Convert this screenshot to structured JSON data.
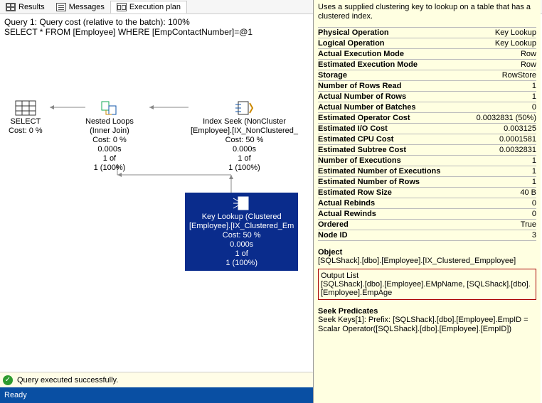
{
  "tabs": {
    "results": "Results",
    "messages": "Messages",
    "plan": "Execution plan"
  },
  "query": {
    "line1": "Query 1: Query cost (relative to the batch): 100%",
    "line2": "SELECT * FROM [Employee] WHERE [EmpContactNumber]=@1"
  },
  "nodes": {
    "select": {
      "title": "SELECT",
      "cost": "Cost: 0 %"
    },
    "nl": {
      "title": "Nested Loops",
      "sub": "(Inner Join)",
      "cost": "Cost: 0 %",
      "t": "0.000s",
      "r1": "1 of",
      "r2": "1 (100%)"
    },
    "seek": {
      "title": "Index Seek (NonCluster",
      "sub": "[Employee].[IX_NonClustered_",
      "cost": "Cost: 50 %",
      "t": "0.000s",
      "r1": "1 of",
      "r2": "1 (100%)"
    },
    "key": {
      "title": "Key Lookup (Clustered",
      "sub": "[Employee].[IX_Clustered_Em",
      "cost": "Cost: 50 %",
      "t": "0.000s",
      "r1": "1 of",
      "r2": "1 (100%)"
    }
  },
  "props": {
    "desc": "Uses a supplied clustering key to lookup on a table that has a clustered index.",
    "rows": [
      {
        "k": "Physical Operation",
        "v": "Key Lookup"
      },
      {
        "k": "Logical Operation",
        "v": "Key Lookup"
      },
      {
        "k": "Actual Execution Mode",
        "v": "Row"
      },
      {
        "k": "Estimated Execution Mode",
        "v": "Row"
      },
      {
        "k": "Storage",
        "v": "RowStore"
      },
      {
        "k": "Number of Rows Read",
        "v": "1"
      },
      {
        "k": "Actual Number of Rows",
        "v": "1"
      },
      {
        "k": "Actual Number of Batches",
        "v": "0"
      },
      {
        "k": "Estimated Operator Cost",
        "v": "0.0032831 (50%)"
      },
      {
        "k": "Estimated I/O Cost",
        "v": "0.003125"
      },
      {
        "k": "Estimated CPU Cost",
        "v": "0.0001581"
      },
      {
        "k": "Estimated Subtree Cost",
        "v": "0.0032831"
      },
      {
        "k": "Number of Executions",
        "v": "1"
      },
      {
        "k": "Estimated Number of Executions",
        "v": "1"
      },
      {
        "k": "Estimated Number of Rows",
        "v": "1"
      },
      {
        "k": "Estimated Row Size",
        "v": "40 B"
      },
      {
        "k": "Actual Rebinds",
        "v": "0"
      },
      {
        "k": "Actual Rewinds",
        "v": "0"
      },
      {
        "k": "Ordered",
        "v": "True"
      },
      {
        "k": "Node ID",
        "v": "3"
      }
    ],
    "object": {
      "hd": "Object",
      "bd": "[SQLShack].[dbo].[Employee].[IX_Clustered_Empployee]"
    },
    "output": {
      "hd": "Output List",
      "bd": "[SQLShack].[dbo].[Employee].EMpName, [SQLShack].[dbo].[Employee].EmpAge"
    },
    "seek": {
      "hd": "Seek Predicates",
      "bd": "Seek Keys[1]: Prefix: [SQLShack].[dbo].[Employee].EmpID = Scalar Operator([SQLShack].[dbo].[Employee].[EmpID])"
    }
  },
  "status": "Query executed successfully.",
  "ready": "Ready"
}
